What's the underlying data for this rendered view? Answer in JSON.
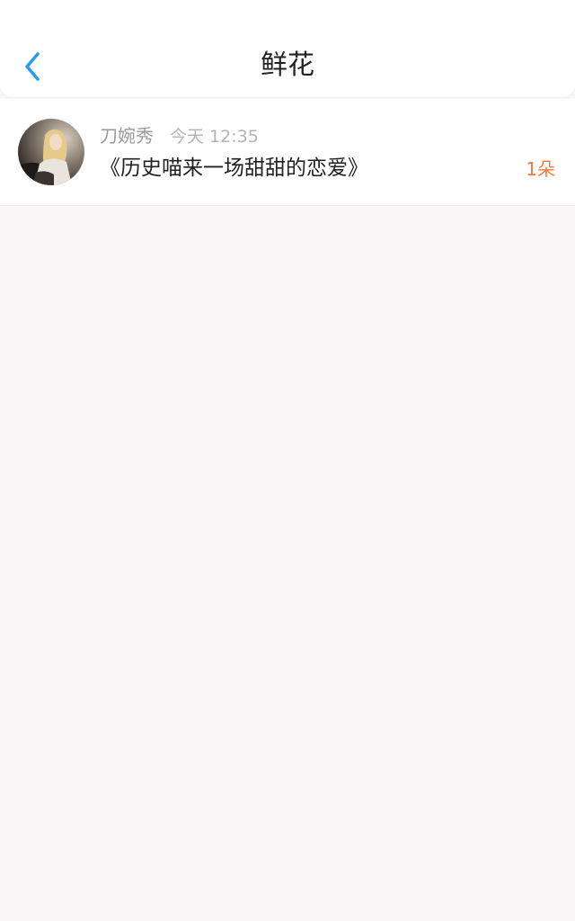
{
  "header": {
    "title": "鲜花",
    "back_icon": "chevron-left-icon"
  },
  "colors": {
    "accent": "#2a9bea",
    "count": "#f47a3b",
    "background": "#f8f6f6"
  },
  "list": {
    "items": [
      {
        "author": "刀婉秀",
        "time": "今天 12:35",
        "title": "《历史喵来一场甜甜的恋爱》",
        "count": "1朵",
        "avatar_icon": "user-avatar"
      }
    ]
  }
}
